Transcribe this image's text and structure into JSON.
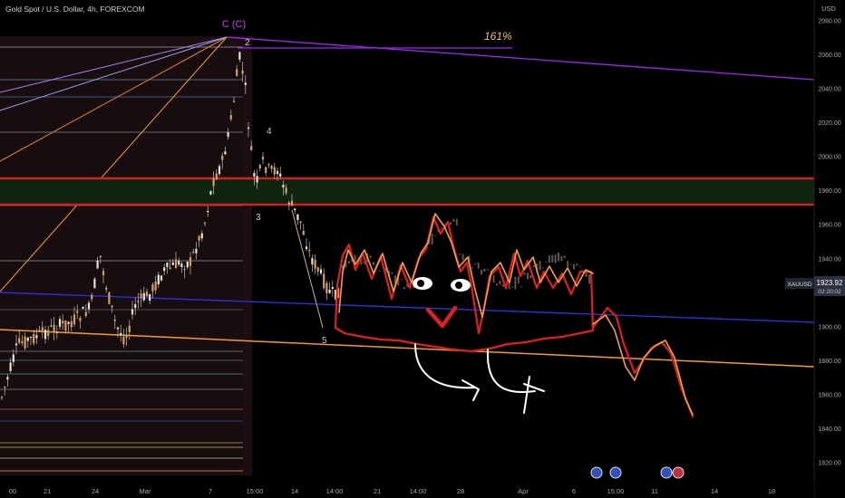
{
  "header": {
    "symbol_title": "Gold Spot / U.S. Dollar, 4h, FOREXCOM",
    "currency": "USD"
  },
  "price_axis": {
    "ticks": [
      2080,
      2060,
      2040,
      2020,
      2000,
      1980,
      1960,
      1940,
      1920,
      1900,
      1880,
      1860,
      1840,
      1820
    ],
    "current_symbol": "XAUUSD",
    "current_price": "1923.92",
    "countdown": "02:20:02"
  },
  "time_axis": {
    "labels": [
      "00",
      "21",
      "24",
      "Mar",
      "7",
      "15:00",
      "14",
      "14:00",
      "21",
      "14:00",
      "28",
      "Apr",
      "6",
      "15:00",
      "11",
      "14",
      "18"
    ]
  },
  "annotations": {
    "wave_c": "C (C)",
    "wave_2": "2",
    "wave_3": "3",
    "wave_4": "4",
    "wave_5": "5",
    "fib_extension": "161%"
  },
  "colors": {
    "background": "#000000",
    "purple_line": "#9c27f0",
    "blue_line": "#2f2fd8",
    "orange_line": "#f39c2a",
    "red_band": "#d32020",
    "green_zone": "#0d2410",
    "drawing_red": "#e02020",
    "drawing_orange": "#f0a040",
    "drawing_white": "#ffffff",
    "candle": "#d8d0c0",
    "axis_text": "#a8a8a8",
    "price_tag_bg": "#2b3140"
  },
  "chart_data": {
    "type": "candlestick",
    "title": "Gold Spot / U.S. Dollar, 4h, FOREXCOM",
    "ylabel": "USD",
    "ylim": [
      1808,
      2092
    ],
    "support_resistance": [
      1985,
      1968
    ],
    "current_price": 1923.92,
    "x_axis": [
      "00",
      "21",
      "24",
      "Mar",
      "7",
      "15:00",
      "14",
      "14:00",
      "21",
      "14:00",
      "28",
      "Apr",
      "6",
      "15:00",
      "11",
      "14",
      "18"
    ],
    "y_ticks": [
      2080,
      2060,
      2040,
      2020,
      2000,
      1980,
      1960,
      1940,
      1920,
      1900,
      1880,
      1860,
      1840,
      1820
    ]
  }
}
